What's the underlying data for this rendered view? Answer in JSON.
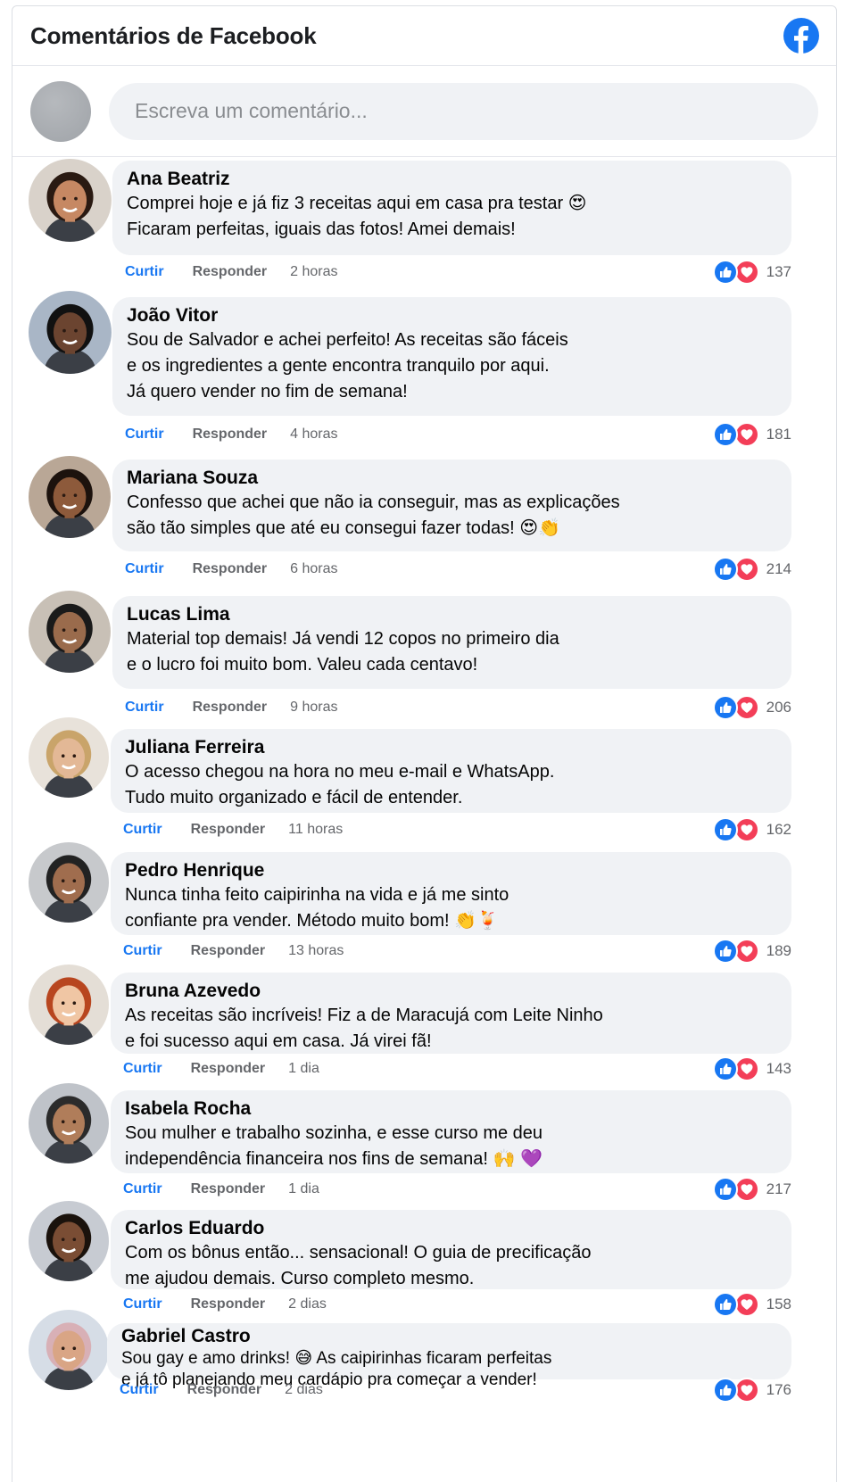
{
  "header": {
    "title": "Comentários de Facebook",
    "logo_icon": "facebook-logo-icon",
    "brand_color": "#1877f2"
  },
  "composer": {
    "placeholder": "Escreva um comentário..."
  },
  "labels": {
    "like": "Curtir",
    "reply": "Responder"
  },
  "comments": [
    {
      "author": "Ana Beatriz",
      "text": "Comprei hoje e já fiz 3 receitas aqui em casa pra testar 😍\nFicaram perfeitas, iguais das fotos! Amei demais!",
      "time": "2 horas",
      "reactions": "137"
    },
    {
      "author": "João Vitor",
      "text": "Sou de Salvador e achei perfeito! As receitas são fáceis\ne os ingredientes a gente encontra tranquilo por aqui.\nJá quero vender no fim de semana!",
      "time": "4 horas",
      "reactions": "181"
    },
    {
      "author": "Mariana Souza",
      "text": "Confesso que achei que não ia conseguir, mas as explicações\nsão tão simples que até eu consegui fazer todas! 😍👏",
      "time": "6 horas",
      "reactions": "214"
    },
    {
      "author": "Lucas Lima",
      "text": "Material top demais! Já vendi 12 copos no primeiro dia\ne o lucro foi muito bom. Valeu cada centavo!",
      "time": "9 horas",
      "reactions": "206"
    },
    {
      "author": "Juliana Ferreira",
      "text": "O acesso chegou na hora no meu e-mail e WhatsApp.\nTudo muito organizado e fácil de entender.",
      "time": "11 horas",
      "reactions": "162"
    },
    {
      "author": "Pedro Henrique",
      "text": "Nunca tinha feito caipirinha na vida e já me sinto\nconfiante pra vender. Método muito bom! 👏🍹",
      "time": "13 horas",
      "reactions": "189"
    },
    {
      "author": "Bruna Azevedo",
      "text": "As receitas são incríveis! Fiz a de Maracujá com Leite Ninho\ne foi sucesso aqui em casa. Já virei fã!",
      "time": "1 dia",
      "reactions": "143"
    },
    {
      "author": "Isabela Rocha",
      "text": "Sou mulher e trabalho sozinha, e esse curso me deu\nindependência financeira nos fins de semana! 🙌 💜",
      "time": "1 dia",
      "reactions": "217"
    },
    {
      "author": "Carlos Eduardo",
      "text": "Com os bônus então... sensacional! O guia de precificação\nme ajudou demais. Curso completo mesmo.",
      "time": "2 dias",
      "reactions": "158"
    },
    {
      "author": "Gabriel Castro",
      "text": "Sou gay e amo drinks! 😅 As caipirinhas ficaram perfeitas\ne já tô planejando meu cardápio pra começar a vender!",
      "time": "2 dias",
      "reactions": "176"
    }
  ]
}
